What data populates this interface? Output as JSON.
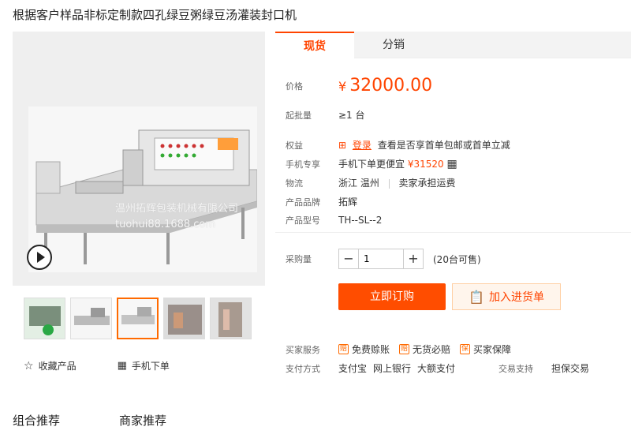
{
  "product": {
    "title": "根据客户样品非标定制款四孔绿豆粥绿豆汤灌装封口机"
  },
  "gallery": {
    "watermark_line1": "温州拓辉包装机械有限公司",
    "watermark_line2": "tuohui88.1688.com",
    "thumbs": [
      "thumb-1",
      "thumb-2",
      "thumb-3",
      "thumb-4",
      "thumb-5"
    ]
  },
  "actions": {
    "favorite": "收藏产品",
    "mobile_order": "手机下单"
  },
  "tabs": {
    "spot": "现货",
    "distribution": "分销"
  },
  "info": {
    "price_label": "价格",
    "currency": "¥",
    "price": "32000.00",
    "moq_label": "起批量",
    "moq_value": "≥1 台",
    "rights_label": "权益",
    "login": "登录",
    "rights_text": "查看是否享首单包邮或首单立减",
    "mobile_label": "手机专享",
    "mobile_text": "手机下单更便宜",
    "mobile_price": "¥31520",
    "logistics_label": "物流",
    "location": "浙江 温州",
    "shipping": "卖家承担运费",
    "brand_label": "产品品牌",
    "brand": "拓辉",
    "model_label": "产品型号",
    "model": "TH--SL--2"
  },
  "purchase": {
    "qty_label": "采购量",
    "qty": "1",
    "available": "(20台可售)",
    "buy_now": "立即订购",
    "add_cart": "加入进货单"
  },
  "service": {
    "label": "买家服务",
    "items": [
      {
        "icon": "赔",
        "text": "免费赊账"
      },
      {
        "icon": "赔",
        "text": "无货必赔"
      },
      {
        "icon": "保",
        "text": "买家保障"
      }
    ],
    "pay_label": "支付方式",
    "pay_methods": [
      "支付宝",
      "网上银行",
      "大额支付"
    ],
    "trade_label": "交易支持",
    "trade_value": "担保交易"
  },
  "bottom": {
    "combo": "组合推荐",
    "merchant": "商家推荐"
  },
  "colors": {
    "accent": "#ff4400",
    "button": "#ff4d00"
  }
}
